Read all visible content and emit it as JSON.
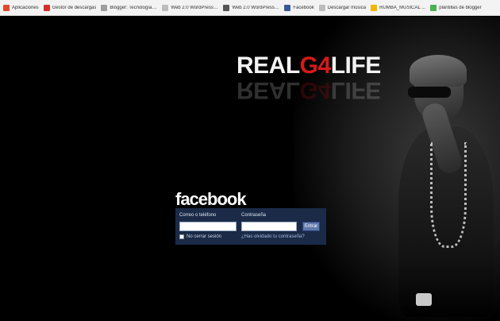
{
  "bookmarks": [
    {
      "label": "Aplicaciones",
      "icon": "apps-grid-icon",
      "color": "#e04a2a"
    },
    {
      "label": "Gestor de descargas",
      "icon": "download-icon",
      "color": "#d32f2f"
    },
    {
      "label": "Blogger: Tecnología y ...",
      "icon": "page-icon",
      "color": "#9e9e9e"
    },
    {
      "label": "Web 2.0 WordPress ...",
      "icon": "page-icon",
      "color": "#bdbdbd"
    },
    {
      "label": "Web 2.0 WordPress ...",
      "icon": "wordpress-icon",
      "color": "#555555"
    },
    {
      "label": "Facebook",
      "icon": "facebook-icon",
      "color": "#3b5998"
    },
    {
      "label": "Descargar música",
      "icon": "page-icon",
      "color": "#bdbdbd"
    },
    {
      "label": "RUMBA_MUSICAL ...",
      "icon": "music-icon",
      "color": "#f2b600"
    },
    {
      "label": "plantillas de blogger",
      "icon": "blogger-icon",
      "color": "#4caf50"
    }
  ],
  "hero": {
    "logo_left": "REAL",
    "logo_mid": "G4",
    "logo_right": "LIFE",
    "logo_red": "#d61a1a"
  },
  "login": {
    "wordmark": "facebook",
    "email_label": "Correo o teléfono",
    "password_label": "Contraseña",
    "email_value": "",
    "password_value": "",
    "submit_label": "Entrar",
    "remember_label": "No cerrar sesión",
    "forgot_label": "¿Has olvidado tu contraseña?",
    "panel_color": "#1a2a47",
    "button_color": "#5f78ab"
  }
}
